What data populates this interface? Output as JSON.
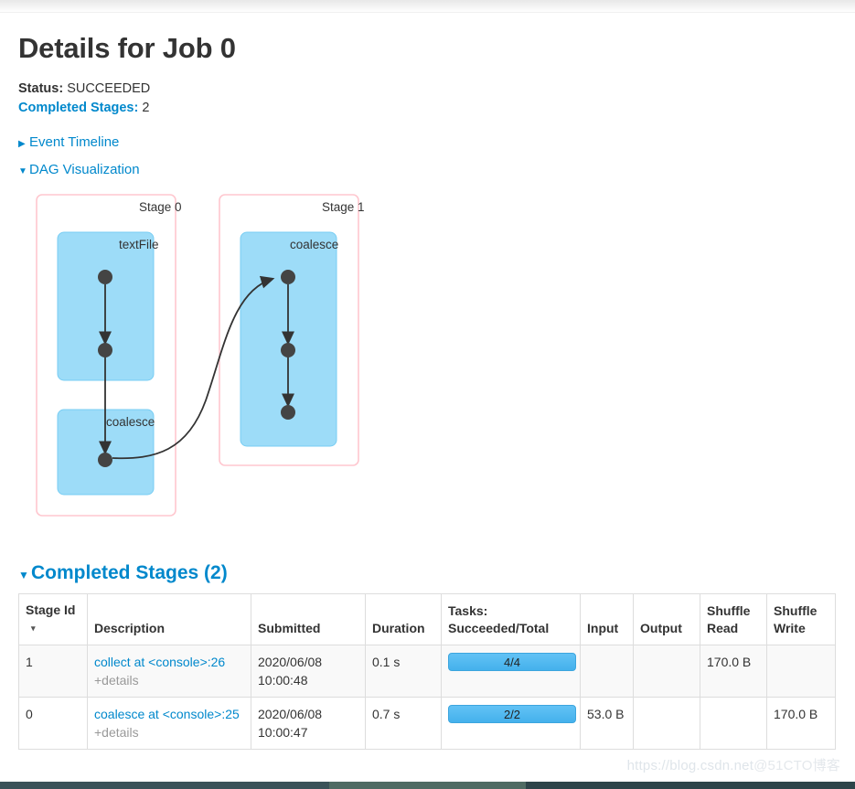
{
  "page": {
    "title": "Details for Job 0"
  },
  "summary": {
    "status_label": "Status:",
    "status_value": "SUCCEEDED",
    "completed_stages_label": "Completed Stages:",
    "completed_stages_value": "2"
  },
  "togglers": [
    {
      "icon": "triangle-right-icon",
      "caret": "▶",
      "label": "Event Timeline",
      "expanded": false
    },
    {
      "icon": "triangle-down-icon",
      "caret": "▼",
      "label": "DAG Visualization",
      "expanded": true
    }
  ],
  "dag": {
    "stages": [
      {
        "label": "Stage 0",
        "rdds": [
          {
            "label": "textFile"
          },
          {
            "label": "coalesce"
          }
        ]
      },
      {
        "label": "Stage 1",
        "rdds": [
          {
            "label": "coalesce"
          }
        ]
      }
    ]
  },
  "completed_section": {
    "caret": "▼",
    "title": "Completed Stages (2)"
  },
  "table": {
    "columns": [
      "Stage Id",
      "Description",
      "Submitted",
      "Duration",
      "Tasks: Succeeded/Total",
      "Input",
      "Output",
      "Shuffle Read",
      "Shuffle Write"
    ],
    "sort_caret": "▾",
    "details_label": "+details",
    "rows": [
      {
        "stage_id": "1",
        "description_link": "collect at <console>:26",
        "submitted": "2020/06/08 10:00:48",
        "duration": "0.1 s",
        "tasks": "4/4",
        "input": "",
        "output": "",
        "shuffle_read": "170.0 B",
        "shuffle_write": ""
      },
      {
        "stage_id": "0",
        "description_link": "coalesce at <console>:25",
        "submitted": "2020/06/08 10:00:47",
        "duration": "0.7 s",
        "tasks": "2/2",
        "input": "53.0 B",
        "output": "",
        "shuffle_read": "",
        "shuffle_write": "170.0 B"
      }
    ]
  },
  "watermark": {
    "url": "https://blog.csdn.net",
    "brand": "@51CTO博客"
  },
  "colors": {
    "link": "#0088cc",
    "stage_border": "#ffc7cf",
    "rdd_fill": "#9ddcf8",
    "progress": "#44b1ec",
    "bottom_bar": "#2d4449"
  }
}
